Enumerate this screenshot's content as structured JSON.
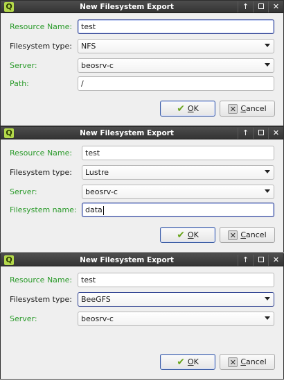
{
  "dialogs": [
    {
      "title": "New Filesystem Export",
      "window_buttons": {
        "up": "↑",
        "close": "✕"
      },
      "resource_name": {
        "label": "Resource Name:",
        "value": "test"
      },
      "filesystem_type": {
        "label": "Filesystem type:",
        "value": "NFS"
      },
      "server": {
        "label": "Server:",
        "value": "beosrv-c"
      },
      "extra": {
        "label": "Path:",
        "value": "/"
      },
      "ok": {
        "mnemonic": "O",
        "rest": "K",
        "icon": "checkmark-icon"
      },
      "cancel": {
        "mnemonic": "C",
        "rest": "ancel",
        "icon": "cancel-icon"
      }
    },
    {
      "title": "New Filesystem Export",
      "window_buttons": {
        "up": "↑",
        "close": "✕"
      },
      "resource_name": {
        "label": "Resource Name:",
        "value": "test"
      },
      "filesystem_type": {
        "label": "Filesystem type:",
        "value": "Lustre"
      },
      "server": {
        "label": "Server:",
        "value": "beosrv-c"
      },
      "extra": {
        "label": "Filesystem name:",
        "value": "data"
      },
      "ok": {
        "mnemonic": "O",
        "rest": "K",
        "icon": "checkmark-icon"
      },
      "cancel": {
        "mnemonic": "C",
        "rest": "ancel",
        "icon": "cancel-icon"
      }
    },
    {
      "title": "New Filesystem Export",
      "window_buttons": {
        "up": "↑",
        "close": "✕"
      },
      "resource_name": {
        "label": "Resource Name:",
        "value": "test"
      },
      "filesystem_type": {
        "label": "Filesystem type:",
        "value": "BeeGFS"
      },
      "server": {
        "label": "Server:",
        "value": "beosrv-c"
      },
      "ok": {
        "mnemonic": "O",
        "rest": "K",
        "icon": "checkmark-icon"
      },
      "cancel": {
        "mnemonic": "C",
        "rest": "ancel",
        "icon": "cancel-icon"
      }
    }
  ],
  "colors": {
    "required_label": "#2a9a2a",
    "titlebar": "#3c3c3c",
    "focus_border": "#2a3d8f"
  }
}
